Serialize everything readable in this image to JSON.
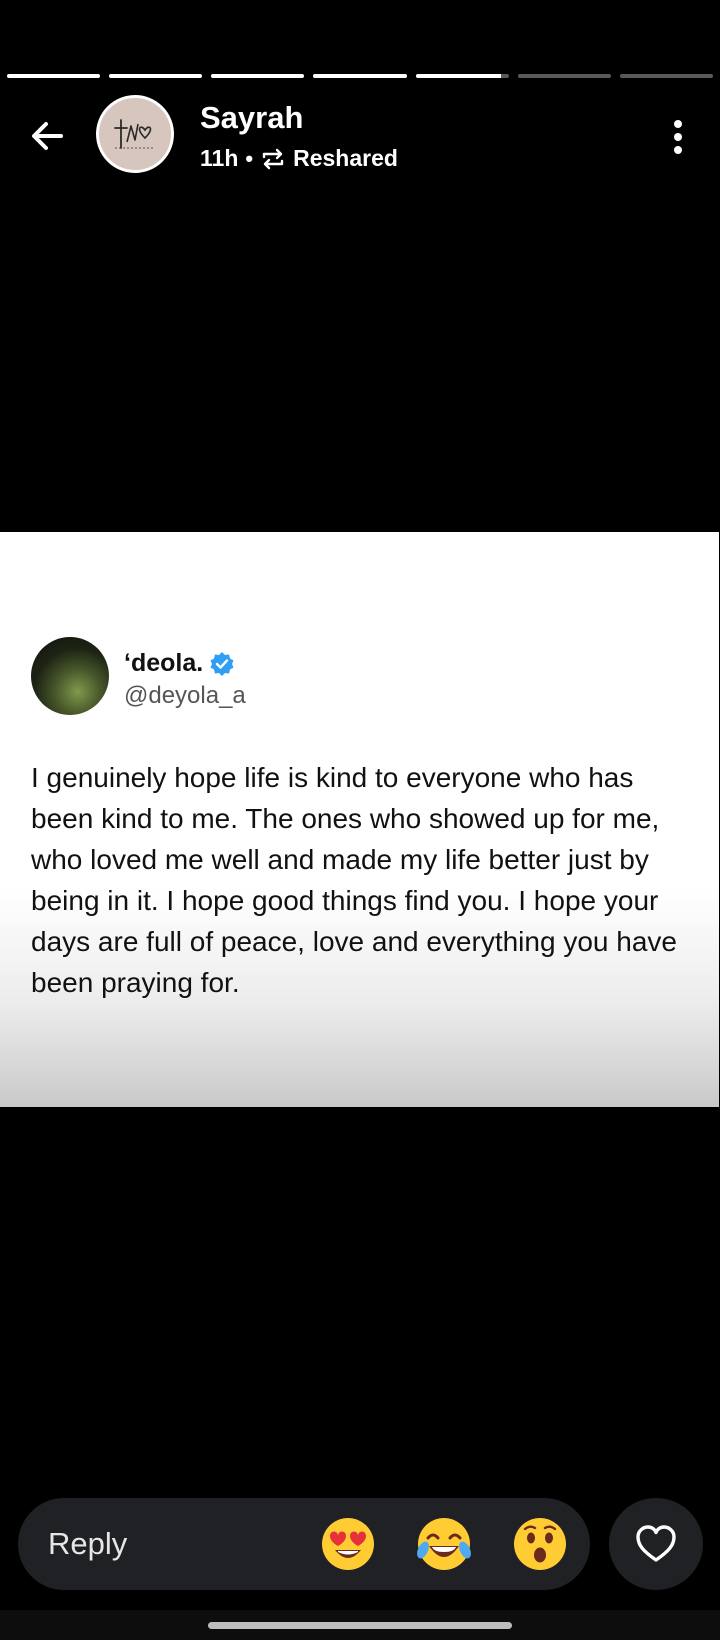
{
  "story": {
    "segments": [
      1,
      1,
      1,
      1,
      0.92,
      0,
      0
    ]
  },
  "header": {
    "user_name": "Sayrah",
    "time": "11h",
    "separator": "•",
    "reshared_label": "Reshared",
    "avatar_icon": "logo-monogram-icon",
    "back_icon": "arrow-left-icon",
    "menu_icon": "more-vertical-icon"
  },
  "post": {
    "author_name": "‘deola.",
    "author_handle": "@deyola_a",
    "verified_icon": "verified-badge-icon",
    "verified_color": "#2f9ef5",
    "text": "I genuinely hope life is kind to everyone who has been kind to me. The ones who showed up for me, who loved me well and made my life better just by being in it. I hope good things find you. I hope your days are full of peace, love and everything you have been praying for."
  },
  "footer": {
    "reply_label": "Reply",
    "reactions": [
      "heart-eyes-emoji",
      "laughing-tears-emoji",
      "surprised-emoji"
    ],
    "like_icon": "heart-outline-icon"
  },
  "colors": {
    "background": "#000000",
    "bar": "#202124"
  }
}
